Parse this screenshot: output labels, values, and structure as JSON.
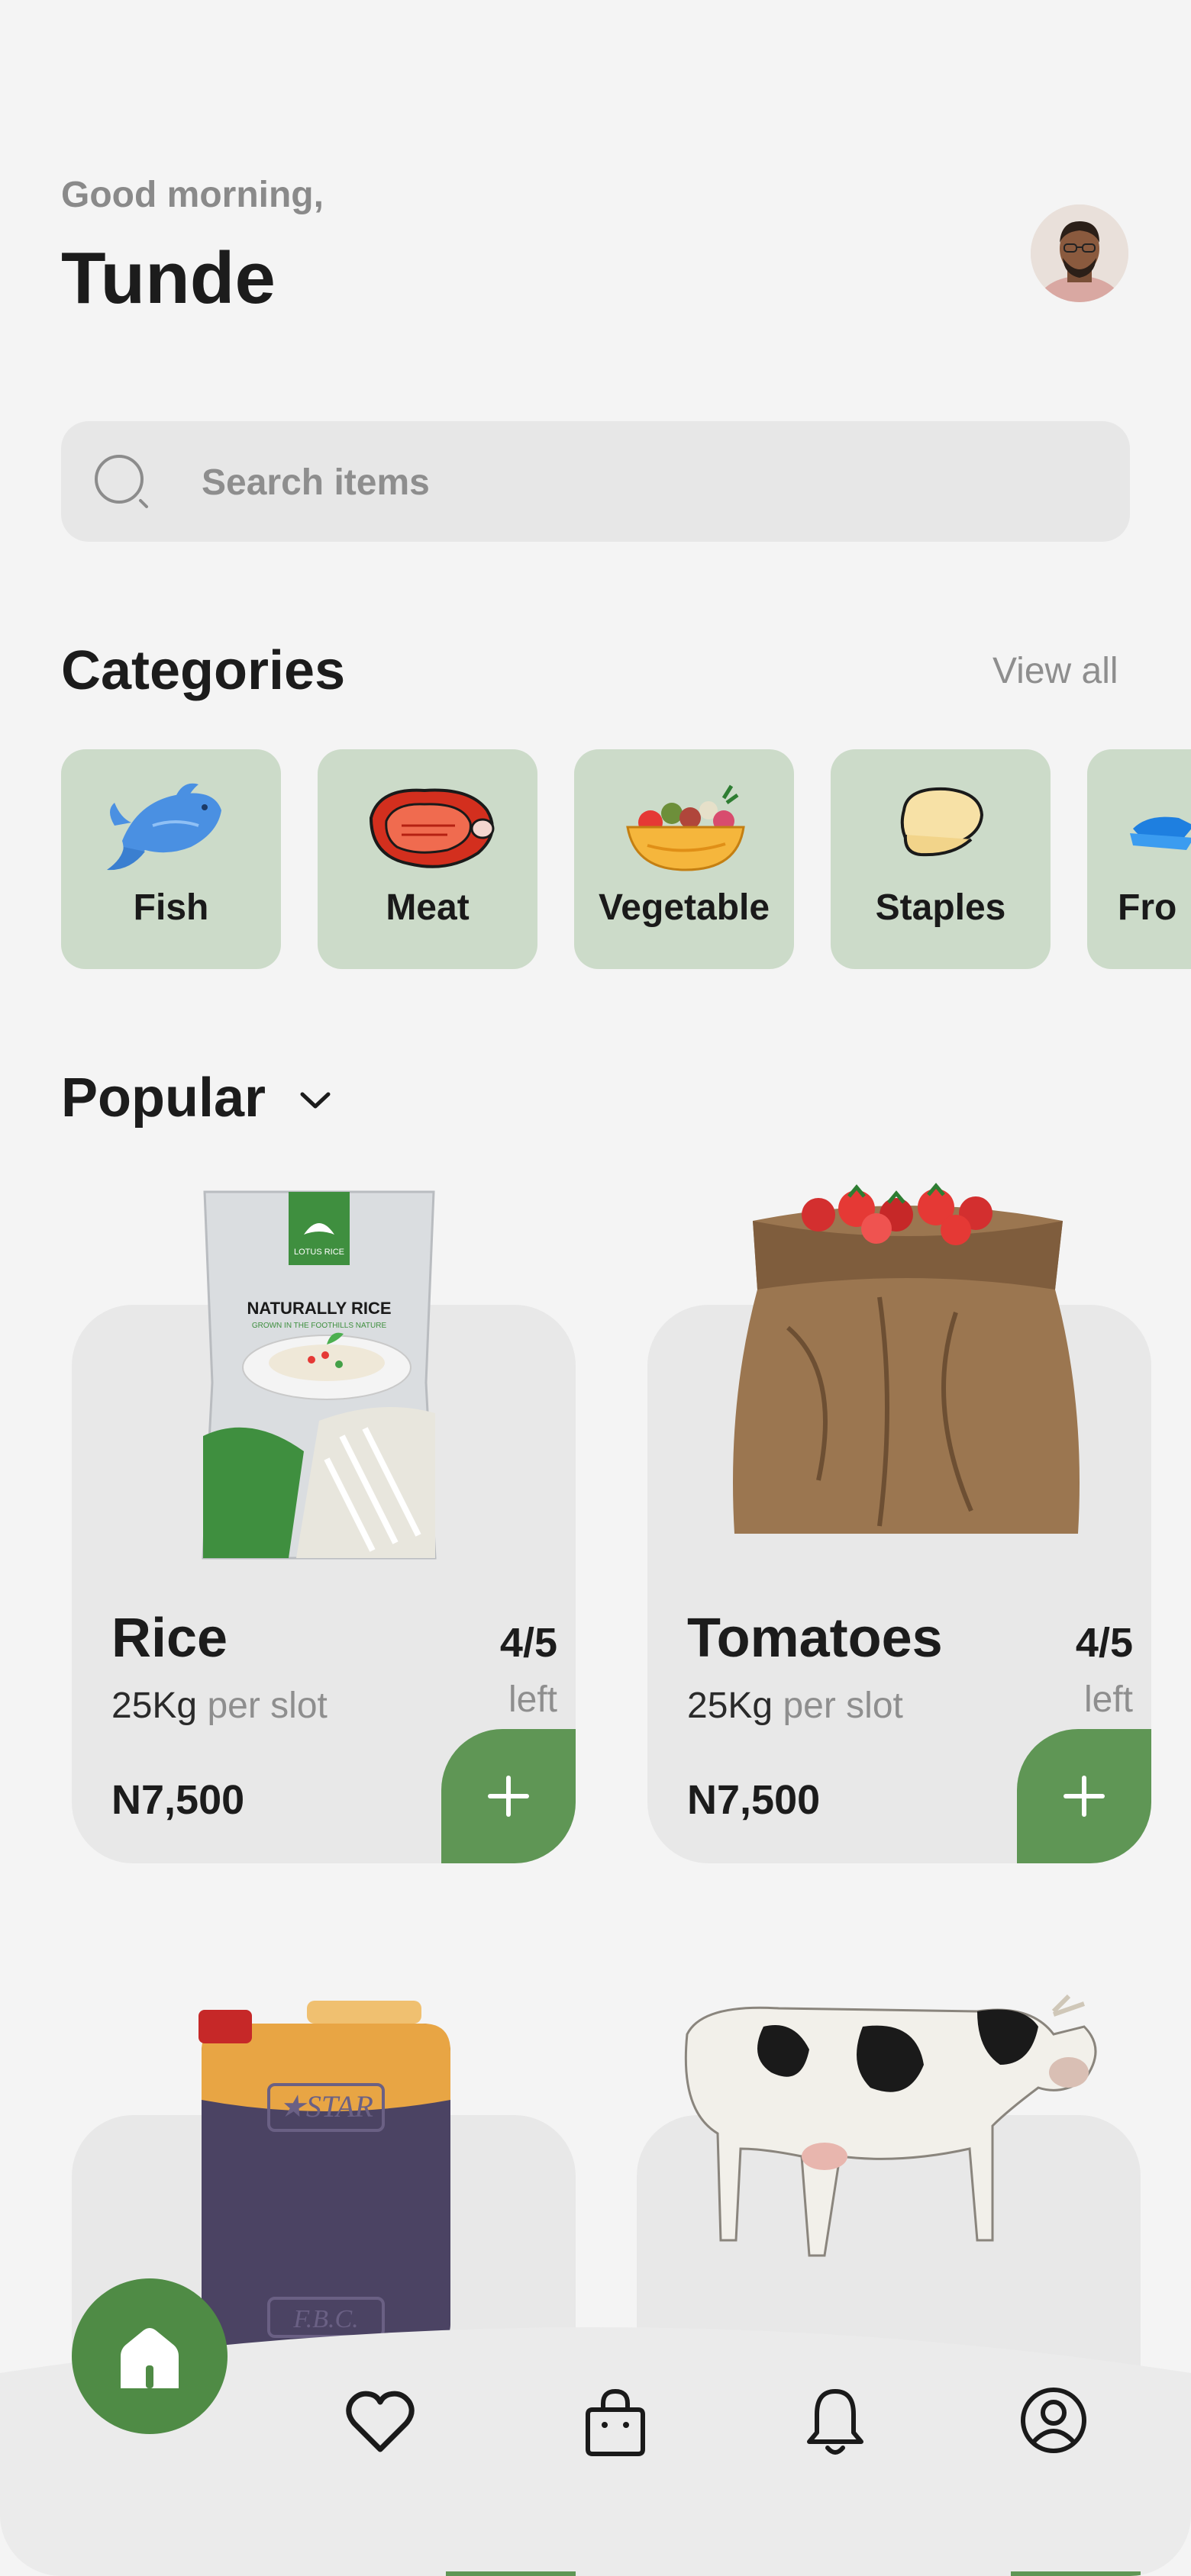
{
  "header": {
    "greeting": "Good morning,",
    "username": "Tunde"
  },
  "search": {
    "placeholder": "Search items"
  },
  "categories": {
    "title": "Categories",
    "view_all": "View all",
    "items": [
      {
        "label": "Fish",
        "icon": "fish-icon"
      },
      {
        "label": "Meat",
        "icon": "meat-icon"
      },
      {
        "label": "Vegetable",
        "icon": "vegetable-bowl-icon"
      },
      {
        "label": "Staples",
        "icon": "staples-icon"
      },
      {
        "label": "Fro",
        "icon": "frozen-icon"
      }
    ]
  },
  "popular": {
    "title": "Popular",
    "products": [
      {
        "name": "Rice",
        "qty": "25Kg",
        "unit": " per slot",
        "stock": "4/5",
        "left": "left",
        "price": "N7,500",
        "image": "rice-bag"
      },
      {
        "name": "Tomatoes",
        "qty": "25Kg",
        "unit": " per slot",
        "stock": "4/5",
        "left": "left",
        "price": "N7,500",
        "image": "tomato-sack"
      },
      {
        "image": "oil-jerrycan"
      },
      {
        "image": "cow"
      }
    ],
    "rice_bag_text": {
      "brand": "LOTUS RICE",
      "title": "NATURALLY RICE",
      "subtitle": "GROWN IN THE FOOTHILLS NATURE"
    },
    "jerrycan_text": {
      "top": "★STAR",
      "bottom": "F.B.C."
    }
  },
  "nav": {
    "items": [
      "home-icon",
      "heart-icon",
      "shopping-bag-icon",
      "bell-icon",
      "profile-icon"
    ]
  },
  "colors": {
    "accent": "#5f9655",
    "category_bg": "#ccdbc9",
    "card_bg": "#e8e8e8",
    "page_bg": "#f4f4f4"
  }
}
